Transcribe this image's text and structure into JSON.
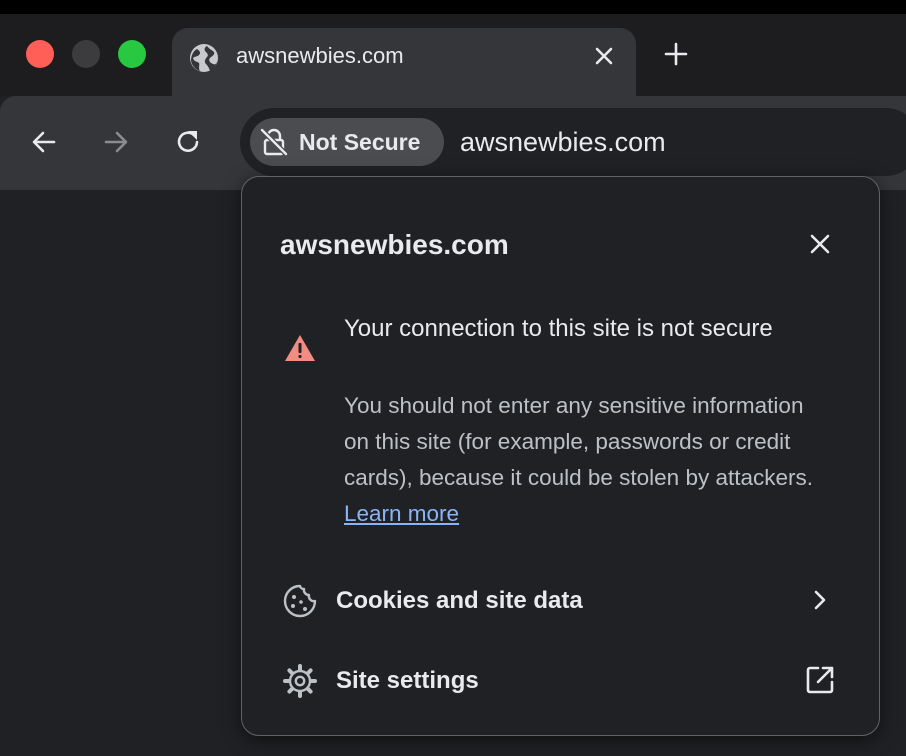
{
  "colors": {
    "chrome_dark": "#202124",
    "toolbar": "#35363a",
    "text_primary": "#e8eaed",
    "text_secondary": "#bdc1c6",
    "link": "#8ab4f8",
    "warning": "#f28b82",
    "traffic_close": "#ff5f57",
    "traffic_minimize": "#3c3c3e",
    "traffic_maximize": "#28c840"
  },
  "tab": {
    "icon": "globe-icon",
    "title": "awsnewbies.com",
    "close_icon": "close-icon"
  },
  "new_tab_icon": "plus-icon",
  "toolbar": {
    "back_icon": "arrow-left-icon",
    "forward_icon": "arrow-right-icon",
    "reload_icon": "reload-icon"
  },
  "omnibox": {
    "security_chip": {
      "icon": "not-secure-lock-icon",
      "label": "Not Secure"
    },
    "url": "awsnewbies.com"
  },
  "popup": {
    "title": "awsnewbies.com",
    "close_icon": "close-icon",
    "warning": {
      "icon": "warning-triangle-icon",
      "heading": "Your connection to this site is not secure",
      "body": "You should not enter any sensitive information on this site (for example, passwords or credit cards), because it could be stolen by attackers. ",
      "link": "Learn more"
    },
    "rows": [
      {
        "icon": "cookie-icon",
        "label": "Cookies and site data",
        "trailing_icon": "chevron-right-icon"
      },
      {
        "icon": "gear-icon",
        "label": "Site settings",
        "trailing_icon": "external-link-icon"
      }
    ]
  }
}
